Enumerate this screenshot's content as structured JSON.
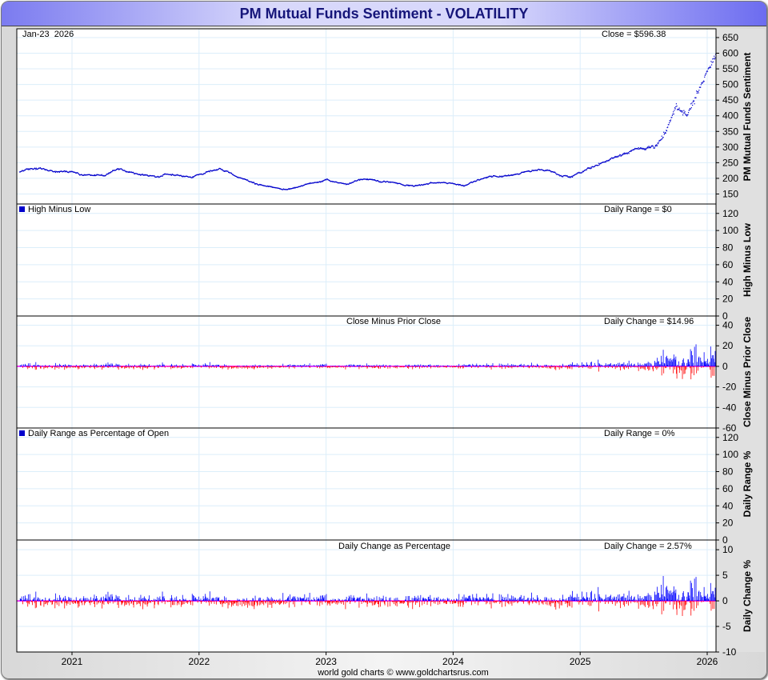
{
  "title": "PM Mutual Funds Sentiment - VOLATILITY",
  "footer": "world gold charts © www.goldchartsrus.com",
  "colors": {
    "price": "#0000cc",
    "up": "#0000ff",
    "down": "#ff0000",
    "zero": "#ff00ff",
    "grid": "#dceefa",
    "title_text": "#16167a"
  },
  "panels": {
    "price": {
      "date_label": "Jan-23  2026",
      "value_label": "Close = $596.38",
      "ylabel": "PM Mutual Funds Sentiment"
    },
    "hml": {
      "legend": "High Minus Low",
      "value_label": "Daily Range = $0",
      "ylabel": "High Minus Low"
    },
    "cmpc": {
      "center_label": "Close Minus Prior Close",
      "value_label": "Daily Change = $14.96",
      "ylabel": "Close Minus Prior Close"
    },
    "drp": {
      "legend": "Daily Range as Percentage of Open",
      "value_label": "Daily Range = 0%",
      "ylabel": "Daily Range %"
    },
    "dcp": {
      "center_label": "Daily Change as Percentage",
      "value_label": "Daily Change = 2.57%",
      "ylabel": "Daily Change %"
    }
  },
  "chart_data": [
    {
      "type": "scatter",
      "title": "PM Mutual Funds Sentiment",
      "ylabel": "PM Mutual Funds Sentiment",
      "ylim": [
        118,
        678
      ],
      "yticks": [
        150,
        200,
        250,
        300,
        350,
        400,
        450,
        500,
        550,
        600,
        650
      ],
      "xticks": [
        "2021",
        "2022",
        "2023",
        "2024",
        "2025",
        "2026"
      ],
      "x_range": [
        "2020-08",
        "2026-01-23"
      ],
      "monthly_close_x": [
        "2020-08",
        "2020-09",
        "2020-10",
        "2020-11",
        "2020-12",
        "2021-01",
        "2021-02",
        "2021-03",
        "2021-04",
        "2021-05",
        "2021-06",
        "2021-07",
        "2021-08",
        "2021-09",
        "2021-10",
        "2021-11",
        "2021-12",
        "2022-01",
        "2022-02",
        "2022-03",
        "2022-04",
        "2022-05",
        "2022-06",
        "2022-07",
        "2022-08",
        "2022-09",
        "2022-10",
        "2022-11",
        "2022-12",
        "2023-01",
        "2023-02",
        "2023-03",
        "2023-04",
        "2023-05",
        "2023-06",
        "2023-07",
        "2023-08",
        "2023-09",
        "2023-10",
        "2023-11",
        "2023-12",
        "2024-01",
        "2024-02",
        "2024-03",
        "2024-04",
        "2024-05",
        "2024-06",
        "2024-07",
        "2024-08",
        "2024-09",
        "2024-10",
        "2024-11",
        "2024-12",
        "2025-01",
        "2025-02",
        "2025-03",
        "2025-04",
        "2025-05",
        "2025-06",
        "2025-07",
        "2025-08",
        "2025-09",
        "2025-10",
        "2025-11",
        "2025-12",
        "2026-01"
      ],
      "monthly_close_y": [
        220,
        228,
        232,
        225,
        222,
        218,
        212,
        208,
        212,
        228,
        225,
        215,
        210,
        205,
        212,
        210,
        205,
        212,
        222,
        228,
        215,
        195,
        185,
        175,
        172,
        165,
        170,
        182,
        188,
        198,
        185,
        180,
        198,
        198,
        190,
        188,
        180,
        176,
        180,
        185,
        188,
        180,
        176,
        192,
        205,
        212,
        205,
        212,
        222,
        232,
        228,
        210,
        205,
        220,
        235,
        252,
        262,
        275,
        290,
        292,
        300,
        345,
        430,
        400,
        470,
        596.38
      ],
      "last_close": 596.38
    },
    {
      "type": "bar",
      "title": "High Minus Low",
      "ylim": [
        0,
        131
      ],
      "yticks": [
        0,
        20,
        40,
        60,
        80,
        100,
        120
      ],
      "last_value": 0
    },
    {
      "type": "bar",
      "title": "Close Minus Prior Close",
      "ylim": [
        -60,
        49
      ],
      "yticks": [
        -60,
        -40,
        -20,
        0,
        20,
        40
      ],
      "last_value": 14.96,
      "note": "daily differences of the close series"
    },
    {
      "type": "bar",
      "title": "Daily Range as Percentage of Open",
      "ylim": [
        0,
        131
      ],
      "yticks": [
        0,
        20,
        40,
        60,
        80,
        100,
        120
      ],
      "last_value": 0
    },
    {
      "type": "bar",
      "title": "Daily Change as Percentage",
      "ylim": [
        -10,
        11.9
      ],
      "yticks": [
        -10,
        -5,
        0,
        5,
        10
      ],
      "last_value": 2.57
    }
  ]
}
